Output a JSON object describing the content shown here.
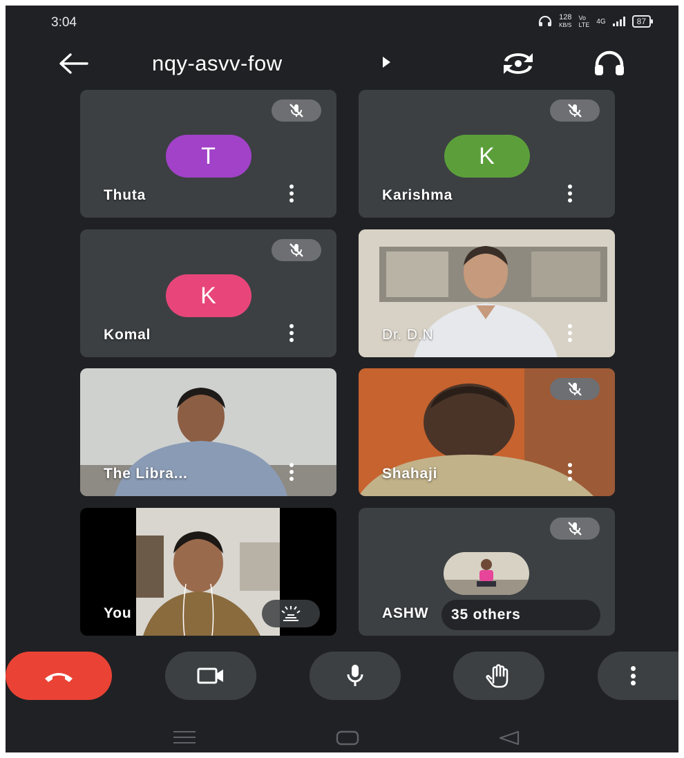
{
  "status_bar": {
    "time": "3:04",
    "speed_value": "128",
    "speed_unit": "KB/S",
    "volte_top": "Vo",
    "volte_bottom": "LTE",
    "network": "4G",
    "battery": "87"
  },
  "header": {
    "meeting_code": "nqy-asvv-fow"
  },
  "participants": [
    {
      "name": "Thuta",
      "initial": "T",
      "color": "#a142c8",
      "muted": true
    },
    {
      "name": "Karishma",
      "initial": "K",
      "color": "#5c9f3a",
      "muted": true
    },
    {
      "name": "Komal",
      "initial": "K",
      "color": "#e8467a",
      "muted": true
    },
    {
      "name": "Dr. D.N",
      "muted": false
    },
    {
      "name": "The Libra...",
      "muted": false
    },
    {
      "name": "Shahaji",
      "muted": true
    },
    {
      "name": "You",
      "muted": false
    },
    {
      "name": "ASHW",
      "others_label": "35 others",
      "muted": true
    }
  ],
  "colors": {
    "background": "#202124",
    "tile": "#3c4043",
    "end_call": "#ea4335"
  },
  "controls": [
    {
      "name": "end-call",
      "icon": "phone-hangup-icon"
    },
    {
      "name": "camera",
      "icon": "video-camera-icon"
    },
    {
      "name": "microphone",
      "icon": "microphone-icon"
    },
    {
      "name": "raise-hand",
      "icon": "hand-icon"
    },
    {
      "name": "more-options",
      "icon": "more-vertical-icon"
    }
  ]
}
